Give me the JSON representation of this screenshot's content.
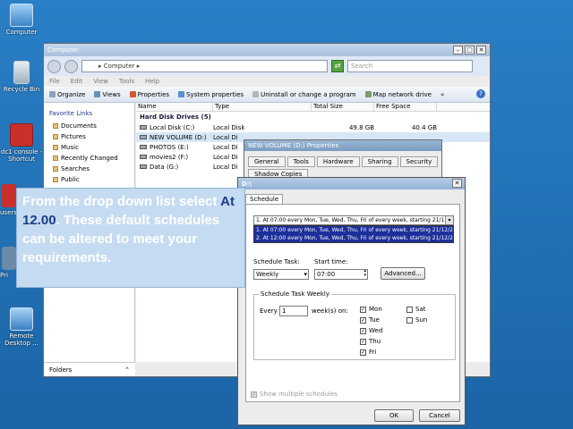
{
  "desktop": {
    "icons": [
      {
        "label": "Computer"
      },
      {
        "label": "Recycle Bin"
      },
      {
        "label": "dc1 console - Shortcut"
      },
      {
        "label": "Remote Desktop ..."
      }
    ],
    "partial_labels": [
      "users",
      "Pri"
    ]
  },
  "explorer": {
    "title": "Computer",
    "address": "▸ Computer ▸",
    "search_placeholder": "Search",
    "menu": [
      "File",
      "Edit",
      "View",
      "Tools",
      "Help"
    ],
    "commands": [
      "Organize",
      "Views",
      "Properties",
      "System properties",
      "Uninstall or change a program",
      "Map network drive",
      "»"
    ],
    "favorites_header": "Favorite Links",
    "favorites": [
      "Documents",
      "Pictures",
      "Music",
      "Recently Changed",
      "Searches",
      "Public"
    ],
    "folders_label": "Folders",
    "columns": [
      "Name",
      "Type",
      "Total Size",
      "Free Space"
    ],
    "group_header": "Hard Disk Drives (5)",
    "drives": [
      {
        "name": "Local Disk (C:)",
        "type": "Local Disk",
        "total": "49.8 GB",
        "free": "40.4 GB"
      },
      {
        "name": "NEW VOLUME (D:)",
        "type": "Local Di",
        "total": "",
        "free": ""
      },
      {
        "name": "PHOTOS (E:)",
        "type": "Local Di",
        "total": "",
        "free": ""
      },
      {
        "name": "movies2 (F:)",
        "type": "Local Di",
        "total": "",
        "free": ""
      },
      {
        "name": "Data (G:)",
        "type": "Local Di",
        "total": "",
        "free": ""
      }
    ]
  },
  "properties": {
    "title": "NEW VOLUME (D:) Properties",
    "tabs_row1": [
      "General",
      "Tools",
      "Hardware",
      "Sharing",
      "Security"
    ],
    "tabs_row2": [
      "Shadow Copies"
    ]
  },
  "scheduler": {
    "title": "D:\\",
    "tab": "Schedule",
    "combo_value": "1. At 07:00 every Mon, Tue, Wed, Thu, Fri of every week, starting 21/1",
    "dropdown_items": [
      "1. At 07:00 every Mon, Tue, Wed, Thu, Fri of every week, starting 21/12/2",
      "2. At 12:00 every Mon, Tue, Wed, Thu, Fri of every week, starting 21/12/2"
    ],
    "schedule_task_label": "Schedule Task:",
    "schedule_task_value": "Weekly",
    "start_time_label": "Start time:",
    "start_time_value": "07:00",
    "advanced_label": "Advanced...",
    "weekly_group_label": "Schedule Task Weekly",
    "every_label": "Every",
    "every_value": "1",
    "weeks_on_label": "week(s) on:",
    "days": [
      {
        "label": "Mon",
        "checked": true
      },
      {
        "label": "Tue",
        "checked": true
      },
      {
        "label": "Wed",
        "checked": true
      },
      {
        "label": "Thu",
        "checked": true
      },
      {
        "label": "Fri",
        "checked": true
      },
      {
        "label": "Sat",
        "checked": false
      },
      {
        "label": "Sun",
        "checked": false
      }
    ],
    "show_multiple_label": "Show multiple schedules",
    "ok_label": "OK",
    "cancel_label": "Cancel"
  },
  "callout": {
    "line_a": "From the drop down list select ",
    "highlight": "At 12.00",
    "line_b": ". These default schedules can be altered to meet your requirements."
  },
  "colors": {
    "callout_bg": "#c5dbf1",
    "callout_emphasis": "#1e3c8c",
    "selection": "#1c2f9a"
  }
}
